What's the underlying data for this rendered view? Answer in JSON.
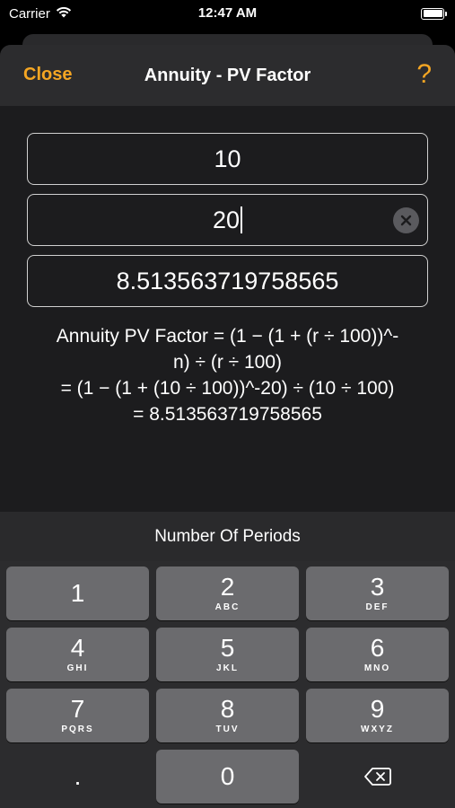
{
  "status_bar": {
    "carrier": "Carrier",
    "time": "12:47 AM"
  },
  "nav": {
    "close_label": "Close",
    "title": "Annuity - PV Factor",
    "help_label": "?"
  },
  "fields": {
    "rate_value": "10",
    "periods_value": "20",
    "result_value": "8.513563719758565"
  },
  "formula": {
    "line1": "Annuity PV Factor = (1 − (1 + (r ÷ 100))^-",
    "line2": "n) ÷ (r ÷ 100)",
    "line3": "= (1 − (1 + (10 ÷ 100))^-20) ÷ (10 ÷ 100)",
    "line4": "= 8.513563719758565"
  },
  "keyboard": {
    "label": "Number Of Periods",
    "keys": [
      {
        "num": "1",
        "letters": ""
      },
      {
        "num": "2",
        "letters": "ABC"
      },
      {
        "num": "3",
        "letters": "DEF"
      },
      {
        "num": "4",
        "letters": "GHI"
      },
      {
        "num": "5",
        "letters": "JKL"
      },
      {
        "num": "6",
        "letters": "MNO"
      },
      {
        "num": "7",
        "letters": "PQRS"
      },
      {
        "num": "8",
        "letters": "TUV"
      },
      {
        "num": "9",
        "letters": "WXYZ"
      },
      {
        "num": ".",
        "letters": ""
      },
      {
        "num": "0",
        "letters": ""
      }
    ]
  },
  "colors": {
    "accent": "#f5a623",
    "sheet_bg": "#1c1c1e",
    "key_bg": "#6b6b6e"
  }
}
